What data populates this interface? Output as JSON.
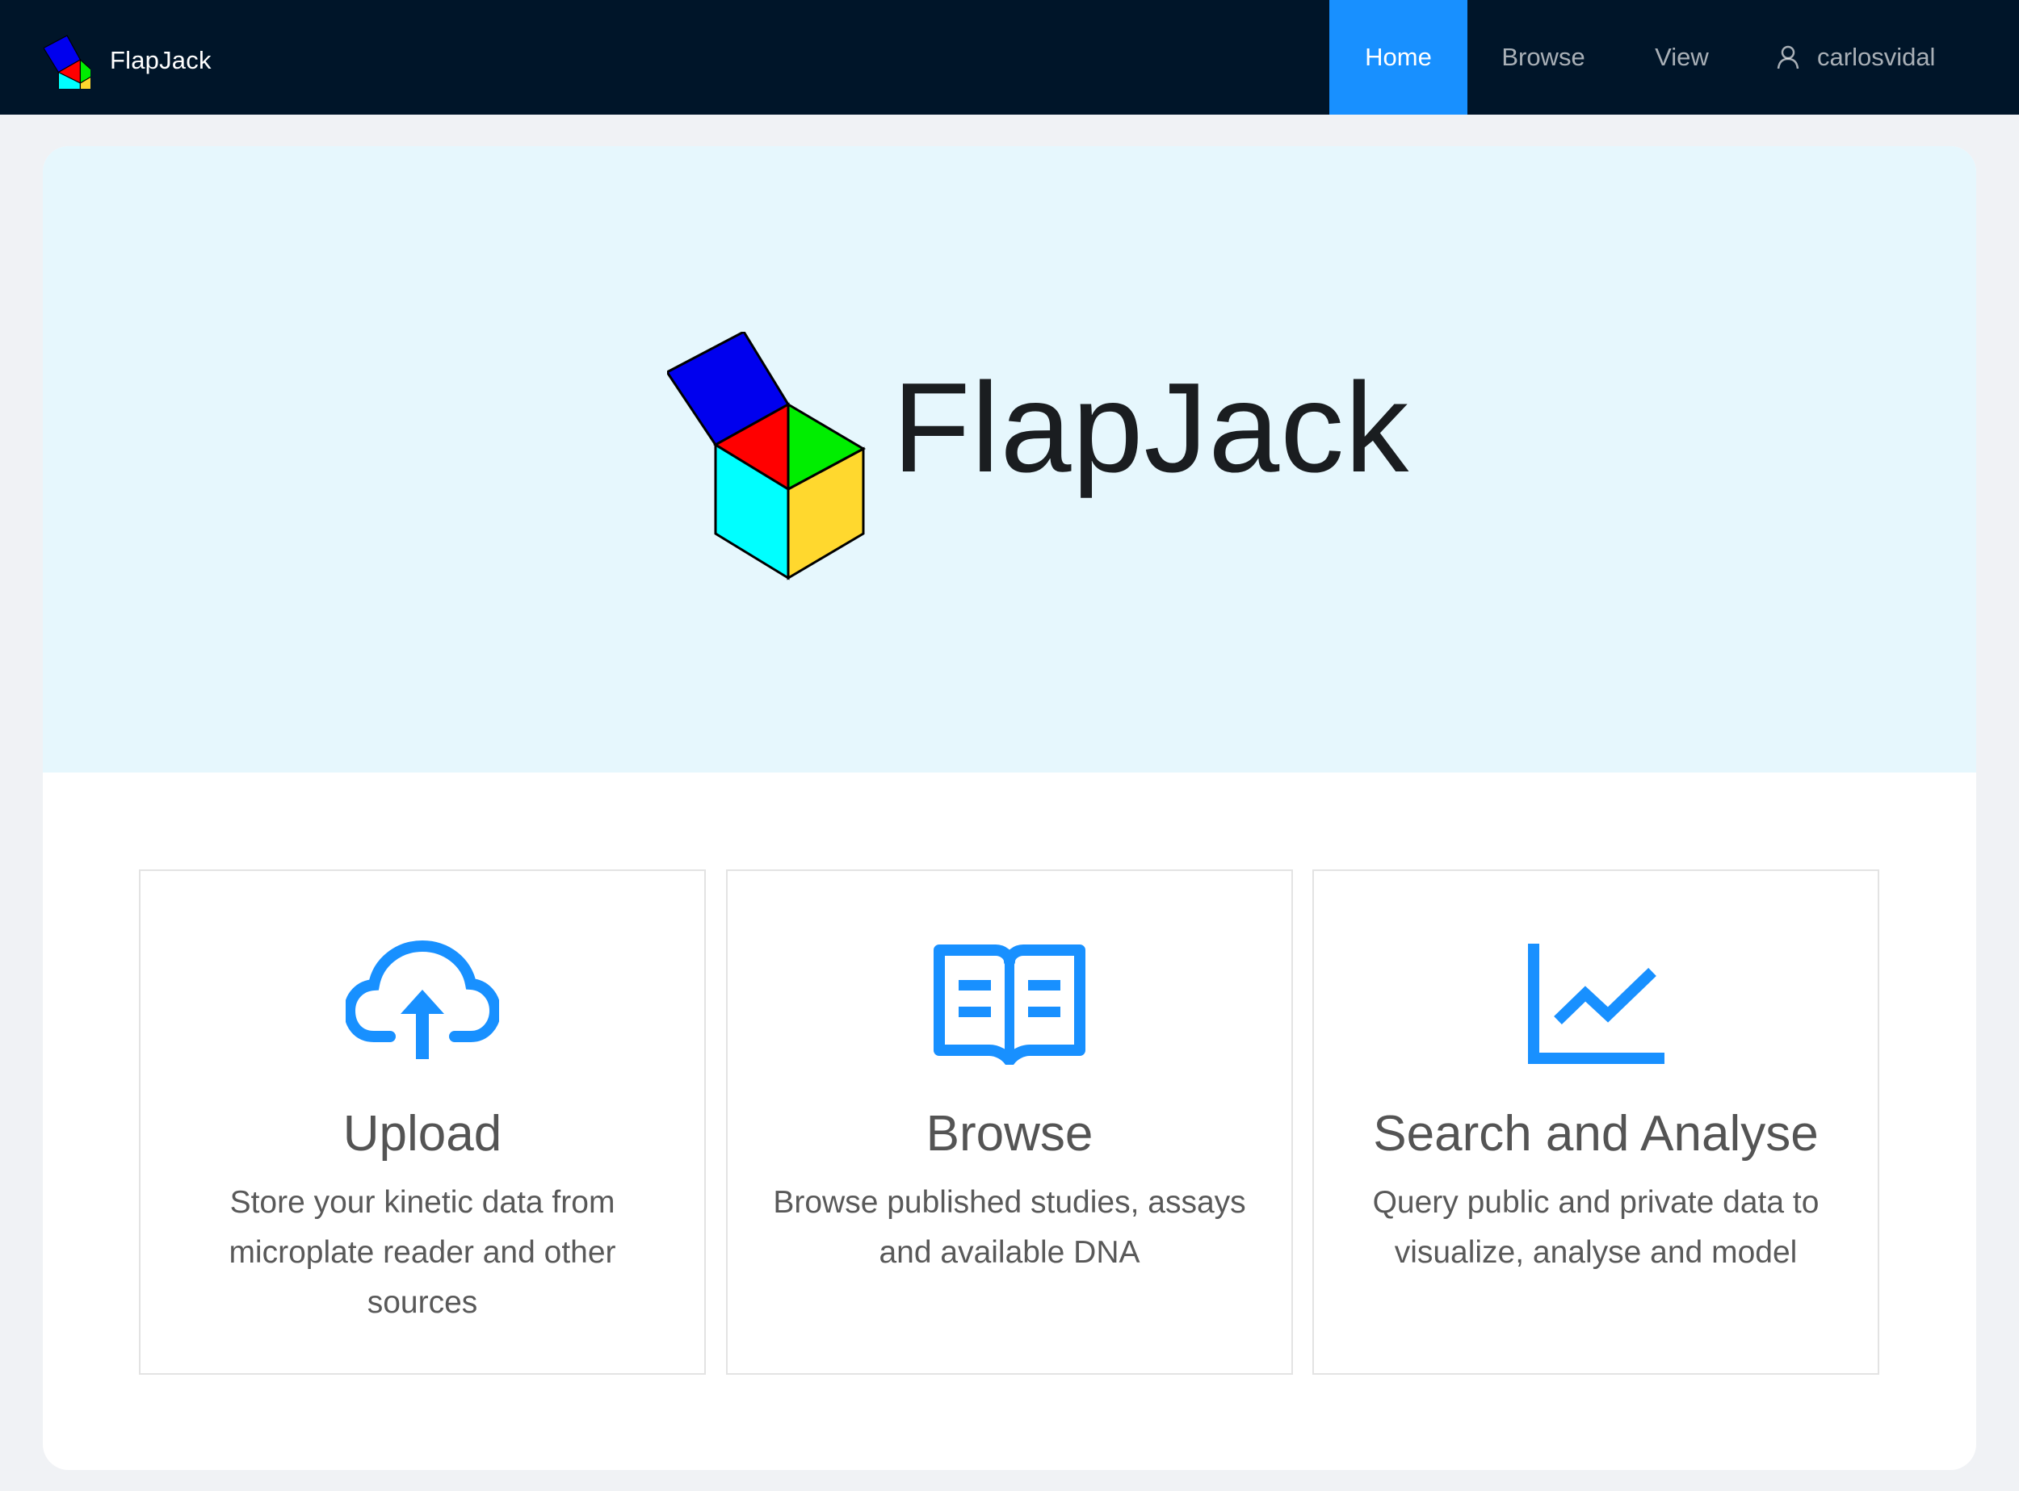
{
  "header": {
    "brand": "FlapJack",
    "nav": [
      {
        "label": "Home",
        "active": true
      },
      {
        "label": "Browse",
        "active": false
      },
      {
        "label": "View",
        "active": false
      }
    ],
    "user": {
      "name": "carlosvidal",
      "icon": "user-icon"
    }
  },
  "hero": {
    "title": "FlapJack",
    "logo": "flapjack-cube-logo"
  },
  "features": [
    {
      "icon": "cloud-upload-icon",
      "title": "Upload",
      "description": "Store your kinetic data from microplate reader and other sources"
    },
    {
      "icon": "book-icon",
      "title": "Browse",
      "description": "Browse published studies, assays and available DNA"
    },
    {
      "icon": "line-chart-icon",
      "title": "Search and Analyse",
      "description": "Query public and private data to visualize, analyse and model"
    }
  ],
  "colors": {
    "header_bg": "#001529",
    "accent": "#1890ff",
    "hero_bg": "#e6f7fd",
    "page_bg": "#f0f2f5"
  }
}
